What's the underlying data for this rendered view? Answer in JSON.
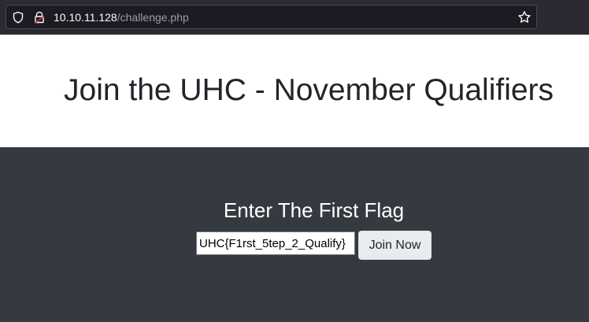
{
  "browser": {
    "url_host": "10.10.11.128",
    "url_path": "/challenge.php",
    "icons": {
      "shield": "shield-icon",
      "lock": "lock-warning-icon",
      "bookmark": "star-icon"
    }
  },
  "header": {
    "title": "Join the UHC - November Qualifiers"
  },
  "form": {
    "heading": "Enter The First Flag",
    "flag_value": "UHC{F1rst_5tep_2_Qualify}",
    "button_label": "Join Now"
  },
  "colors": {
    "header_bg": "#ffffff",
    "form_bg": "#343a40",
    "title_text": "#212529",
    "button_bg": "#e9ecef"
  }
}
